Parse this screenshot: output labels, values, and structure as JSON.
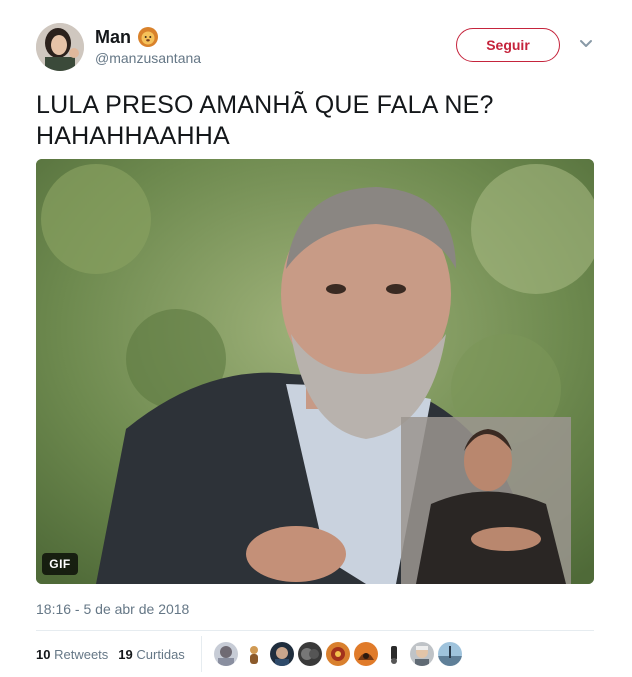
{
  "user": {
    "name": "Man",
    "handle": "@manzusantana",
    "emoji_icon": "lion-face-icon"
  },
  "follow_label": "Seguir",
  "tweet": {
    "line1": "LULA PRESO AMANHÃ QUE FALA NE?",
    "line2": "HAHAHHAAHHA"
  },
  "media": {
    "badge": "GIF"
  },
  "timestamp": "18:16 - 5 de abr de 2018",
  "stats": {
    "retweets_count": "10",
    "retweets_label": "Retweets",
    "likes_count": "19",
    "likes_label": "Curtidas"
  },
  "likers": [
    "liker-avatar-1",
    "liker-avatar-2",
    "liker-avatar-3",
    "liker-avatar-4",
    "liker-avatar-5",
    "liker-avatar-6",
    "liker-avatar-7",
    "liker-avatar-8",
    "liker-avatar-9"
  ],
  "colors": {
    "follow_accent": "#c5243c",
    "secondary_text": "#657786",
    "divider": "#e6ecf0"
  }
}
